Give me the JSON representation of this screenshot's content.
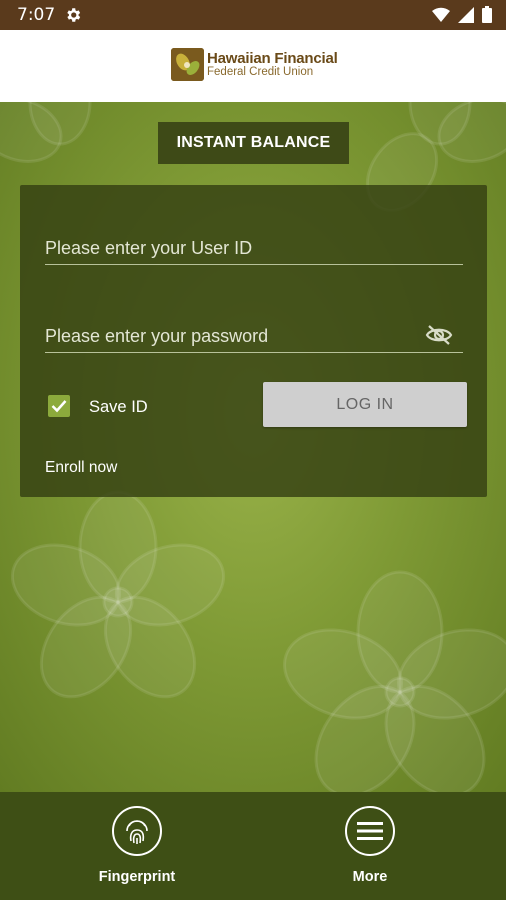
{
  "status_bar": {
    "time": "7:07",
    "icons": [
      "gear-icon",
      "wifi-icon",
      "signal-icon",
      "battery-icon"
    ]
  },
  "header": {
    "logo_line1": "Hawaiian Financial",
    "logo_line2": "Federal Credit Union"
  },
  "instant_balance": {
    "label": "INSTANT BALANCE"
  },
  "login": {
    "userid_placeholder": "Please enter your User ID",
    "password_placeholder": "Please enter your password",
    "save_id_label": "Save ID",
    "save_id_checked": true,
    "login_label": "LOG IN",
    "enroll_label": "Enroll now"
  },
  "bottom_nav": {
    "fingerprint_label": "Fingerprint",
    "more_label": "More"
  },
  "colors": {
    "status_bar": "#5a3a1c",
    "header_bg": "#ffffff",
    "panel_bg": "#344012",
    "instant_balance_bg": "#3e4a17",
    "bottom_bar": "#3e4f15",
    "checkbox": "#8caa3c",
    "login_button": "#cfcfcf"
  }
}
